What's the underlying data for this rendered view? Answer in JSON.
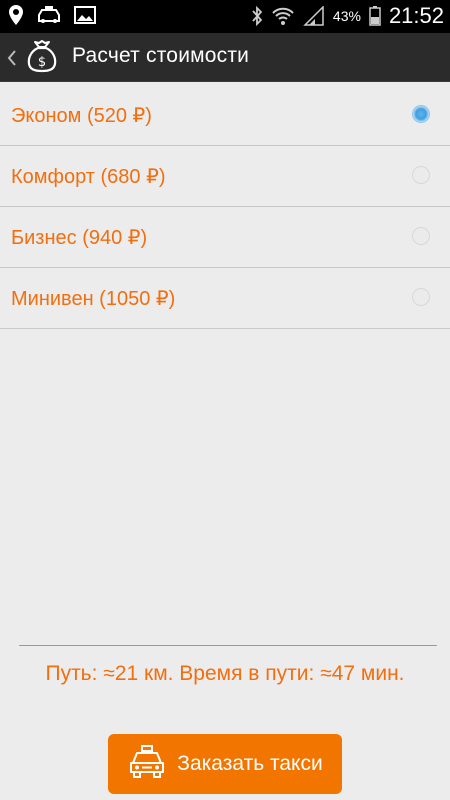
{
  "status_bar": {
    "icons_left": [
      "location-pin-icon",
      "taxi-car-icon",
      "image-icon"
    ],
    "icons_right": [
      "bluetooth-icon",
      "wifi-icon",
      "signal-icon",
      "battery-icon"
    ],
    "battery_percent": "43%",
    "time": "21:52"
  },
  "action_bar": {
    "title": "Расчет стоимости",
    "app_icon": "money-bag-icon"
  },
  "tariffs": [
    {
      "label": "Эконом (520 ₽)",
      "selected": true
    },
    {
      "label": "Комфорт (680 ₽)",
      "selected": false
    },
    {
      "label": "Бизнес (940 ₽)",
      "selected": false
    },
    {
      "label": "Минивен (1050 ₽)",
      "selected": false
    }
  ],
  "route_info": "Путь: ≈21 км. Время в пути: ≈47 мин.",
  "order_button": {
    "label": "Заказать такси",
    "icon": "taxi-icon"
  },
  "colors": {
    "accent": "#f26e0f",
    "button": "#f27500",
    "action_bar": "#2b2b2b",
    "background": "#ececec"
  }
}
